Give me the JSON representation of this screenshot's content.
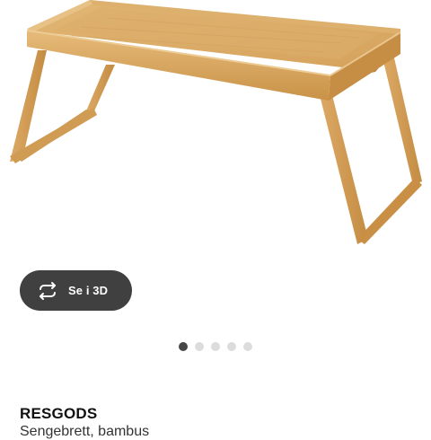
{
  "gallery": {
    "view_3d_label": "Se i 3D",
    "view_3d_icon": "rotate-3d-icon",
    "slides_total": 5,
    "active_slide": 1
  },
  "product": {
    "name": "RESGODS",
    "description": "Sengebrett, bambus"
  },
  "colors": {
    "button_bg": "#404040",
    "dot_active": "#474747",
    "dot_inactive": "#dcdcdc",
    "bamboo": "#d9a861"
  }
}
